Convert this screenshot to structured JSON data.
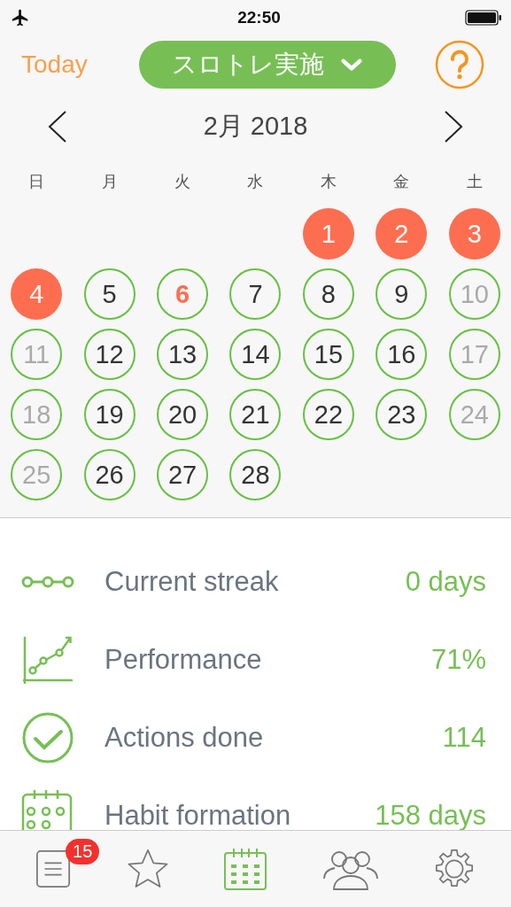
{
  "status_bar": {
    "time": "22:50"
  },
  "header": {
    "today_button": "Today",
    "habit_selector": "スロトレ実施"
  },
  "month_nav": {
    "title": "2月 2018"
  },
  "weekdays": [
    "日",
    "月",
    "火",
    "水",
    "木",
    "金",
    "土"
  ],
  "days": [
    {
      "kind": "empty"
    },
    {
      "kind": "empty"
    },
    {
      "kind": "empty"
    },
    {
      "kind": "empty"
    },
    {
      "kind": "day",
      "day": "1",
      "missed": true,
      "greyed": false,
      "today": false
    },
    {
      "kind": "day",
      "day": "2",
      "missed": true,
      "greyed": false,
      "today": false
    },
    {
      "kind": "day",
      "day": "3",
      "missed": true,
      "greyed": false,
      "today": false
    },
    {
      "kind": "day",
      "day": "4",
      "missed": true,
      "greyed": false,
      "today": false
    },
    {
      "kind": "day",
      "day": "5",
      "missed": false,
      "greyed": false,
      "today": false
    },
    {
      "kind": "day",
      "day": "6",
      "missed": false,
      "greyed": false,
      "today": true
    },
    {
      "kind": "day",
      "day": "7",
      "missed": false,
      "greyed": false,
      "today": false
    },
    {
      "kind": "day",
      "day": "8",
      "missed": false,
      "greyed": false,
      "today": false
    },
    {
      "kind": "day",
      "day": "9",
      "missed": false,
      "greyed": false,
      "today": false
    },
    {
      "kind": "day",
      "day": "10",
      "missed": false,
      "greyed": true,
      "today": false
    },
    {
      "kind": "day",
      "day": "11",
      "missed": false,
      "greyed": true,
      "today": false
    },
    {
      "kind": "day",
      "day": "12",
      "missed": false,
      "greyed": false,
      "today": false
    },
    {
      "kind": "day",
      "day": "13",
      "missed": false,
      "greyed": false,
      "today": false
    },
    {
      "kind": "day",
      "day": "14",
      "missed": false,
      "greyed": false,
      "today": false
    },
    {
      "kind": "day",
      "day": "15",
      "missed": false,
      "greyed": false,
      "today": false
    },
    {
      "kind": "day",
      "day": "16",
      "missed": false,
      "greyed": false,
      "today": false
    },
    {
      "kind": "day",
      "day": "17",
      "missed": false,
      "greyed": true,
      "today": false
    },
    {
      "kind": "day",
      "day": "18",
      "missed": false,
      "greyed": true,
      "today": false
    },
    {
      "kind": "day",
      "day": "19",
      "missed": false,
      "greyed": false,
      "today": false
    },
    {
      "kind": "day",
      "day": "20",
      "missed": false,
      "greyed": false,
      "today": false
    },
    {
      "kind": "day",
      "day": "21",
      "missed": false,
      "greyed": false,
      "today": false
    },
    {
      "kind": "day",
      "day": "22",
      "missed": false,
      "greyed": false,
      "today": false
    },
    {
      "kind": "day",
      "day": "23",
      "missed": false,
      "greyed": false,
      "today": false
    },
    {
      "kind": "day",
      "day": "24",
      "missed": false,
      "greyed": true,
      "today": false
    },
    {
      "kind": "day",
      "day": "25",
      "missed": false,
      "greyed": true,
      "today": false
    },
    {
      "kind": "day",
      "day": "26",
      "missed": false,
      "greyed": false,
      "today": false
    },
    {
      "kind": "day",
      "day": "27",
      "missed": false,
      "greyed": false,
      "today": false
    },
    {
      "kind": "day",
      "day": "28",
      "missed": false,
      "greyed": false,
      "today": false
    }
  ],
  "stats": [
    {
      "kind": "streak",
      "label": "Current streak",
      "value": "0 days"
    },
    {
      "kind": "performance",
      "label": "Performance",
      "value": "71%"
    },
    {
      "kind": "actions",
      "label": "Actions done",
      "value": "114"
    },
    {
      "kind": "habit",
      "label": "Habit formation",
      "value": "158 days"
    }
  ],
  "tab_bar": [
    {
      "kind": "list",
      "selected": false,
      "badge": "15"
    },
    {
      "kind": "star",
      "selected": false
    },
    {
      "kind": "calendar",
      "selected": true
    },
    {
      "kind": "people",
      "selected": false
    },
    {
      "kind": "settings",
      "selected": false
    }
  ]
}
